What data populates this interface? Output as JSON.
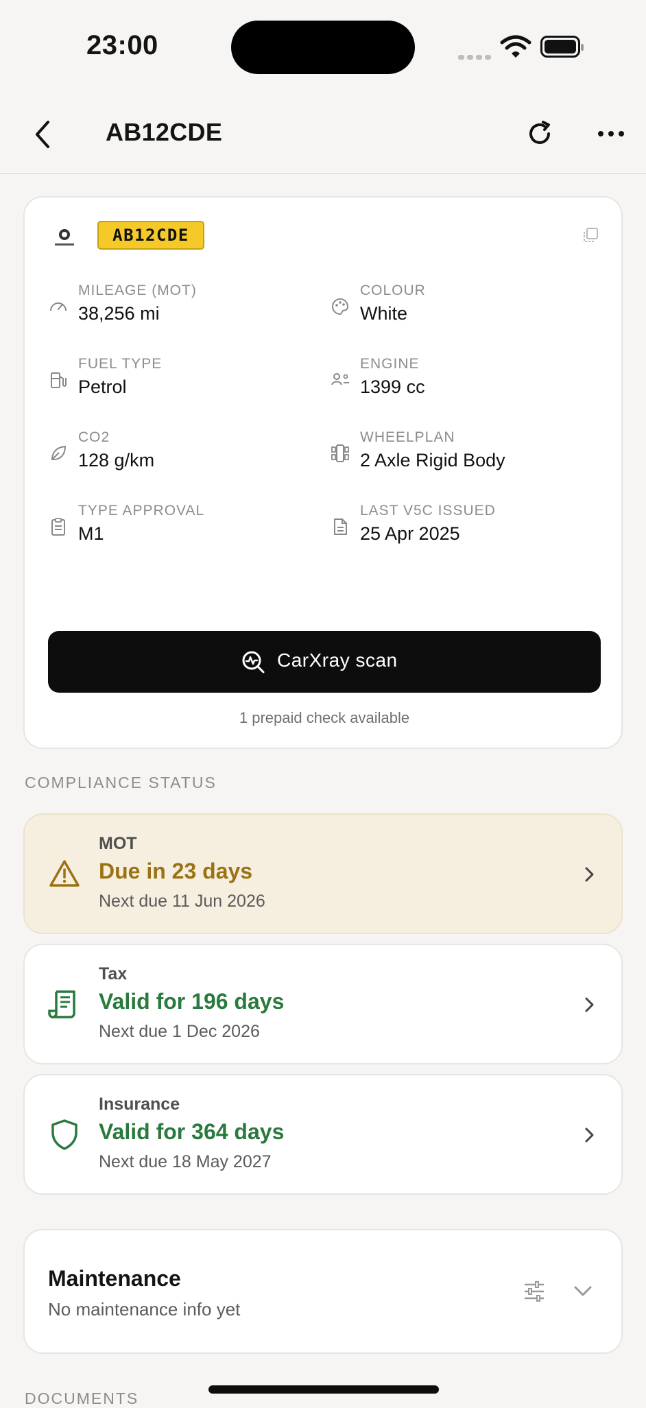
{
  "status_bar": {
    "time": "23:00"
  },
  "nav": {
    "title": "AB12CDE",
    "icons": {
      "back": "chevron-left-icon",
      "refresh": "refresh-icon",
      "more": "more-horizontal-icon"
    }
  },
  "vehicle": {
    "plate": "AB12CDE",
    "fields": [
      {
        "label": "MILEAGE (MOT)",
        "value": "38,256 mi",
        "icon": "speedometer-icon"
      },
      {
        "label": "COLOUR",
        "value": "White",
        "icon": "palette-icon"
      },
      {
        "label": "FUEL TYPE",
        "value": "Petrol",
        "icon": "fuel-pump-icon"
      },
      {
        "label": "ENGINE",
        "value": "1399 cc",
        "icon": "engine-icon"
      },
      {
        "label": "CO2",
        "value": "128 g/km",
        "icon": "leaf-icon"
      },
      {
        "label": "WHEELPLAN",
        "value": "2 Axle Rigid Body",
        "icon": "wheelplan-icon"
      },
      {
        "label": "TYPE APPROVAL",
        "value": "M1",
        "icon": "clipboard-icon"
      },
      {
        "label": "LAST V5C ISSUED",
        "value": "25 Apr 2025",
        "icon": "document-icon"
      }
    ],
    "scan_button": "CarXray scan",
    "prepaid_note": "1 prepaid check available"
  },
  "compliance": {
    "heading": "COMPLIANCE STATUS",
    "items": [
      {
        "type": "MOT",
        "headline": "Due in 23 days",
        "sub": "Next due 11 Jun 2026",
        "status": "warning",
        "icon": "warning-triangle-icon"
      },
      {
        "type": "Tax",
        "headline": "Valid for 196 days",
        "sub": "Next due 1 Dec 2026",
        "status": "valid",
        "icon": "receipt-icon"
      },
      {
        "type": "Insurance",
        "headline": "Valid for 364 days",
        "sub": "Next due 18 May 2027",
        "status": "valid",
        "icon": "shield-icon"
      }
    ]
  },
  "maintenance": {
    "title": "Maintenance",
    "subtitle": "No maintenance info yet"
  },
  "documents": {
    "heading": "DOCUMENTS"
  },
  "colors": {
    "amber": "#9b7213",
    "green": "#2a7a3e",
    "plate": "#f4c928",
    "warn_bg": "#f6efe0"
  }
}
